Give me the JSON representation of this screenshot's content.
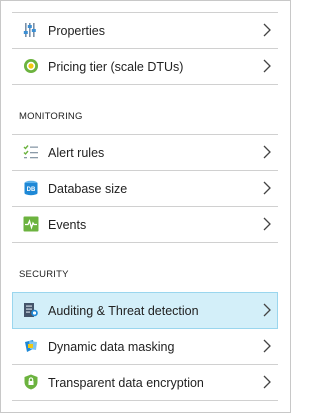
{
  "top_items": [
    {
      "label": "Properties",
      "icon": "properties-icon"
    },
    {
      "label": "Pricing tier (scale DTUs)",
      "icon": "pricing-tier-icon"
    }
  ],
  "monitoring": {
    "title": "MONITORING",
    "items": [
      {
        "label": "Alert rules",
        "icon": "alert-rules-icon"
      },
      {
        "label": "Database size",
        "icon": "database-size-icon",
        "icon_text": "DB"
      },
      {
        "label": "Events",
        "icon": "events-icon"
      }
    ]
  },
  "security": {
    "title": "SECURITY",
    "items": [
      {
        "label": "Auditing & Threat detection",
        "icon": "auditing-icon",
        "selected": true
      },
      {
        "label": "Dynamic data masking",
        "icon": "data-masking-icon"
      },
      {
        "label": "Transparent data encryption",
        "icon": "encryption-shield-icon"
      }
    ]
  },
  "colors": {
    "selected_bg": "#d3eff9",
    "selected_border": "#9ad6ee",
    "divider": "#d0d0d0",
    "green_accent": "#6cb33f",
    "blue_accent": "#1e88d6"
  }
}
